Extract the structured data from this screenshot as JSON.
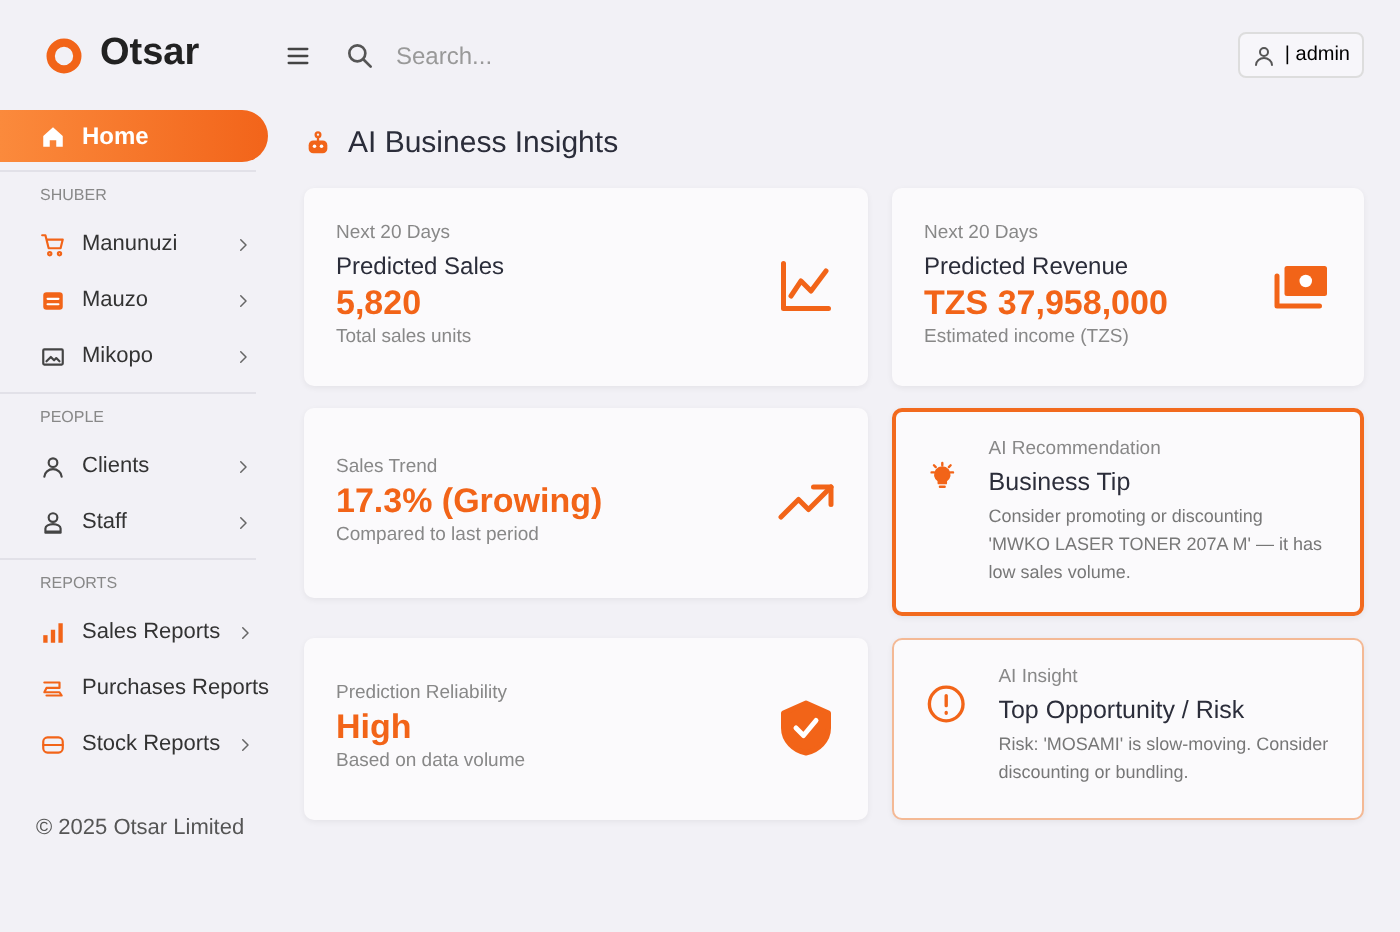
{
  "brand": "Otsar",
  "search": {
    "placeholder": "Search..."
  },
  "user": {
    "label": "| admin"
  },
  "sidebar": {
    "items": [
      {
        "kind": "item",
        "label": "Home",
        "selected": true,
        "submenu": false
      },
      {
        "kind": "section",
        "label": "SHUBER"
      },
      {
        "kind": "item",
        "label": "Manunuzi",
        "selected": false,
        "submenu": true
      },
      {
        "kind": "item",
        "label": "Mauzo",
        "selected": false,
        "submenu": true
      },
      {
        "kind": "item",
        "label": "Mikopo",
        "selected": false,
        "submenu": true
      },
      {
        "kind": "section",
        "label": "PEOPLE"
      },
      {
        "kind": "item",
        "label": "Clients",
        "selected": false,
        "submenu": true
      },
      {
        "kind": "item",
        "label": "Staff",
        "selected": false,
        "submenu": true
      },
      {
        "kind": "section",
        "label": "REPORTS"
      },
      {
        "kind": "item",
        "label": "Sales Reports",
        "selected": false,
        "submenu": true
      },
      {
        "kind": "item",
        "label": "Purchases Reports",
        "selected": false,
        "submenu": false
      },
      {
        "kind": "item",
        "label": "Stock Reports",
        "selected": false,
        "submenu": true
      }
    ],
    "footer": "© 2025 Otsar Limited"
  },
  "page_title": "AI Business Insights",
  "cards": [
    {
      "kind": "stat",
      "caption": "Next 20 Days",
      "title": "Predicted Sales",
      "value": "5,820",
      "note": "Total sales units"
    },
    {
      "kind": "stat",
      "caption": "Next 20 Days",
      "title": "Predicted Revenue",
      "value": "TZS 37,958,000",
      "note": "Estimated income (TZS)"
    },
    {
      "kind": "stat",
      "caption": "Sales Trend",
      "value": "17.3% (Growing)",
      "note": "Compared to last period"
    },
    {
      "kind": "notice",
      "highlighted": true,
      "caption": "AI Recommendation",
      "title": "Business Tip",
      "note": "Consider promoting or discounting 'MWKO LASER TONER 207A M' — it has low sales volume."
    },
    {
      "kind": "stat",
      "caption": "Prediction Reliability",
      "value": "High",
      "note": "Based on data volume"
    },
    {
      "kind": "notice",
      "highlighted": false,
      "caption": "AI Insight",
      "title": "Top Opportunity / Risk",
      "note": "Risk: 'MOSAMI' is slow-moving. Consider discounting or bundling."
    }
  ]
}
